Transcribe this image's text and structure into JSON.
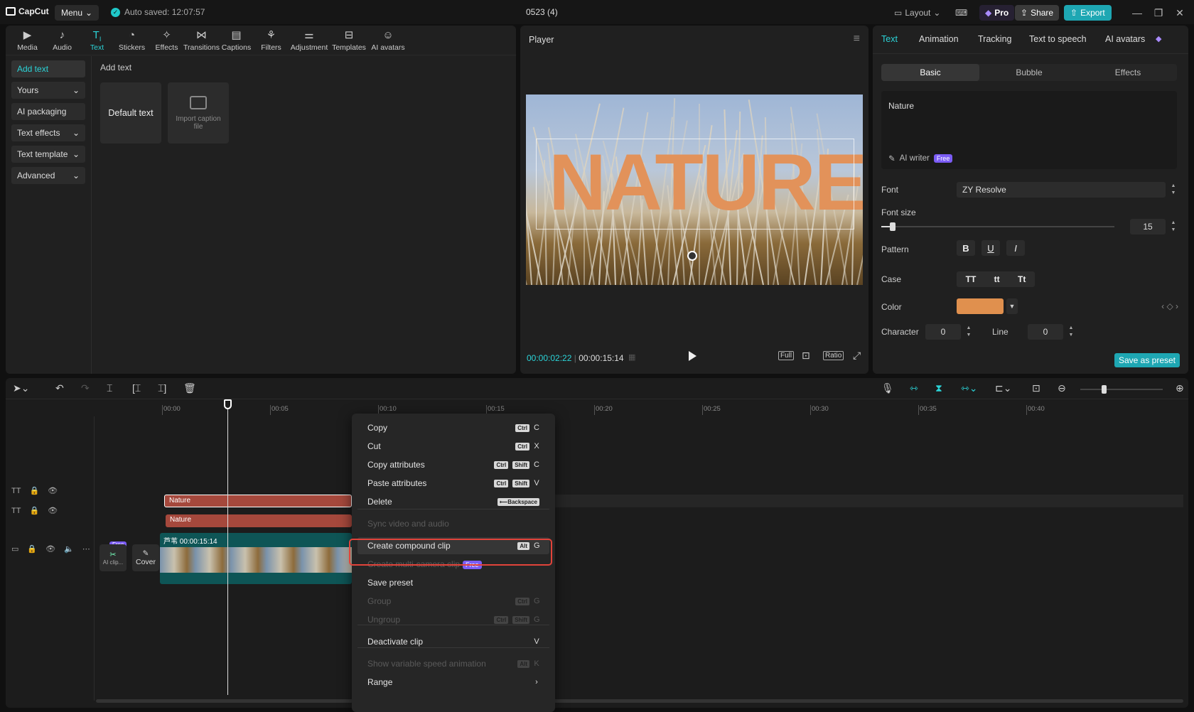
{
  "titlebar": {
    "app_name": "CapCut",
    "menu_label": "Menu",
    "autosave": "Auto saved: 12:07:57",
    "project_title": "0523 (4)",
    "layout_label": "Layout",
    "pro_label": "Pro",
    "share_label": "Share",
    "export_label": "Export"
  },
  "toolbar": {
    "items": [
      "Media",
      "Audio",
      "Text",
      "Stickers",
      "Effects",
      "Transitions",
      "Captions",
      "Filters",
      "Adjustment",
      "Templates",
      "AI avatars"
    ],
    "active": "Text"
  },
  "sidenav": {
    "items": [
      {
        "label": "Add text",
        "active": true,
        "dropdown": false
      },
      {
        "label": "Yours",
        "active": false,
        "dropdown": true
      },
      {
        "label": "AI packaging",
        "active": false,
        "dropdown": false
      },
      {
        "label": "Text effects",
        "active": false,
        "dropdown": true
      },
      {
        "label": "Text template",
        "active": false,
        "dropdown": true
      },
      {
        "label": "Advanced",
        "active": false,
        "dropdown": true
      }
    ]
  },
  "add_text": {
    "section_title": "Add text",
    "default_card": "Default text",
    "import_card_line1": "Import caption",
    "import_card_line2": "file"
  },
  "player": {
    "title": "Player",
    "overlay_text": "NATURE",
    "time_current": "00:00:02:22",
    "time_total": "00:00:15:14",
    "full_label": "Full",
    "ratio_label": "Ratio"
  },
  "right_panel": {
    "tabs": [
      "Text",
      "Animation",
      "Tracking",
      "Text to speech",
      "AI avatars"
    ],
    "active_tab": "Text",
    "subtabs": [
      "Basic",
      "Bubble",
      "Effects"
    ],
    "active_subtab": "Basic",
    "text_value": "Nature",
    "ai_writer": "AI writer",
    "free_badge": "Free",
    "font_label": "Font",
    "font_value": "ZY Resolve",
    "font_size_label": "Font size",
    "font_size_value": "15",
    "font_size_fraction": 0.05,
    "pattern_label": "Pattern",
    "pattern_bold": "B",
    "pattern_underline": "U",
    "pattern_italic": "I",
    "case_label": "Case",
    "case_options": [
      "TT",
      "tt",
      "Tt"
    ],
    "color_label": "Color",
    "color_value": "#e0904e",
    "character_label": "Character",
    "character_value": "0",
    "line_label": "Line",
    "line_value": "0",
    "save_preset": "Save as preset"
  },
  "timeline": {
    "ruler": [
      "00:00",
      "00:05",
      "00:10",
      "00:15",
      "00:20",
      "00:25",
      "00:30",
      "00:35",
      "00:40"
    ],
    "text_clip_1": "Nature",
    "text_clip_2": "Nature",
    "video_clip_duration": "00:00:15:14",
    "video_clip_label": "芦苇",
    "cover_label": "Cover",
    "ai_clip_label": "AI clip...",
    "free_tag": "Free"
  },
  "context_menu": {
    "items": [
      {
        "label": "Copy",
        "keys": [
          "Ctrl"
        ],
        "char": "C",
        "disabled": false
      },
      {
        "label": "Cut",
        "keys": [
          "Ctrl"
        ],
        "char": "X",
        "disabled": false
      },
      {
        "label": "Copy attributes",
        "keys": [
          "Ctrl",
          "Shift"
        ],
        "char": "C",
        "disabled": false
      },
      {
        "label": "Paste attributes",
        "keys": [
          "Ctrl",
          "Shift"
        ],
        "char": "V",
        "disabled": false
      },
      {
        "label": "Delete",
        "keys": [
          "⟵Backspace"
        ],
        "char": "",
        "disabled": false
      },
      {
        "label": "Sync video and audio",
        "keys": [],
        "char": "",
        "disabled": true
      },
      {
        "label": "Create compound clip",
        "keys": [
          "Alt"
        ],
        "char": "G",
        "disabled": false
      },
      {
        "label": "Create multi-camera clip",
        "keys": [],
        "char": "",
        "disabled": true,
        "badge": "Free"
      },
      {
        "label": "Save preset",
        "keys": [],
        "char": "",
        "disabled": false
      },
      {
        "label": "Group",
        "keys": [
          "Ctrl"
        ],
        "char": "G",
        "disabled": true
      },
      {
        "label": "Ungroup",
        "keys": [
          "Ctrl",
          "Shift"
        ],
        "char": "G",
        "disabled": true
      },
      {
        "label": "Deactivate clip",
        "keys": [],
        "char": "V",
        "disabled": false
      },
      {
        "label": "Show variable speed animation",
        "keys": [
          "Alt"
        ],
        "char": "K",
        "disabled": true
      },
      {
        "label": "Range",
        "keys": [],
        "char": "›",
        "disabled": false
      }
    ]
  }
}
